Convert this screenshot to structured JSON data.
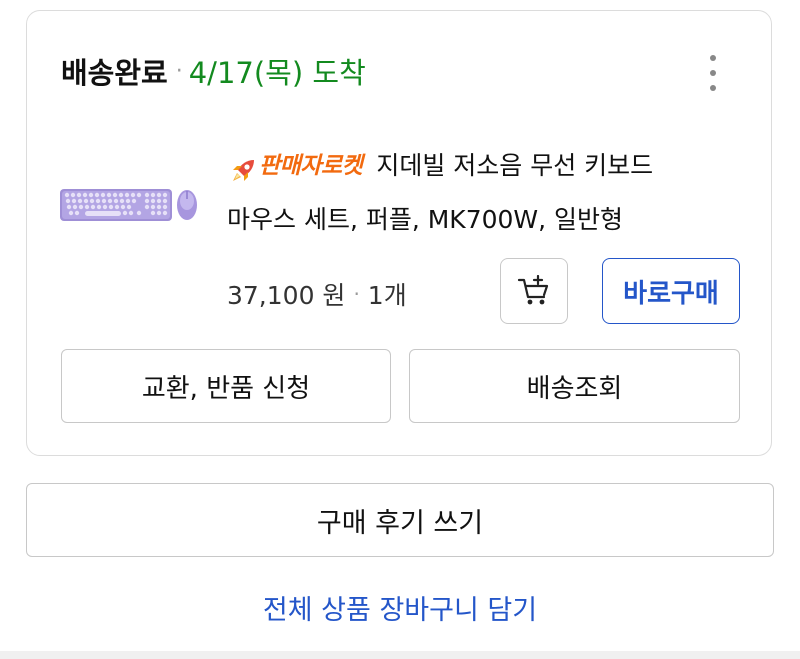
{
  "order": {
    "status_label": "배송완료",
    "status_separator": "·",
    "arrival_text": "4/17(목) 도착",
    "more_icon": "more-vertical-icon"
  },
  "product": {
    "thumbnail_icon": "keyboard-mouse-thumbnail",
    "rocket_icon": "rocket-icon",
    "badge": "판매자로켓",
    "title_line1": "지데빌 저소음 무선 키보드",
    "title_line2": "마우스 세트, 퍼플, MK700W, 일반형",
    "price": "37,100 원",
    "separator": "·",
    "quantity": "1개"
  },
  "buttons": {
    "cart_icon": "add-to-cart-icon",
    "buy_now": "바로구매",
    "return_exchange": "교환, 반품 신청",
    "track_delivery": "배송조회",
    "write_review": "구매 후기 쓰기",
    "add_all_to_cart": "전체 상품 장바구니 담기"
  },
  "colors": {
    "arrival": "#138a1f",
    "rocket_badge": "#f26a0f",
    "accent_blue": "#2456c9"
  }
}
